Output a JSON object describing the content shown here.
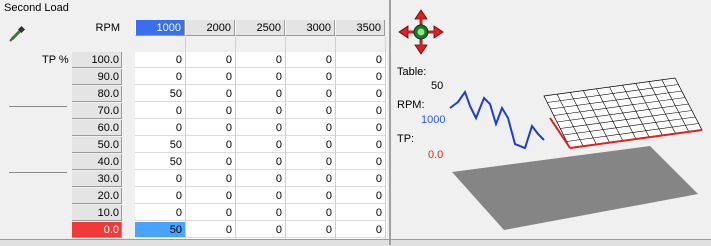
{
  "title": "Second Load",
  "axis": {
    "rpm_label": "RPM",
    "tp_label": "TP %"
  },
  "rpm": [
    "1000",
    "2000",
    "2500",
    "3000",
    "3500"
  ],
  "tp": [
    "100.0",
    "90.0",
    "80.0",
    "70.0",
    "60.0",
    "50.0",
    "40.0",
    "30.0",
    "20.0",
    "10.0",
    "0.0"
  ],
  "table": [
    [
      "0",
      "0",
      "0",
      "0",
      "0"
    ],
    [
      "0",
      "0",
      "0",
      "0",
      "0"
    ],
    [
      "50",
      "0",
      "0",
      "0",
      "0"
    ],
    [
      "0",
      "0",
      "0",
      "0",
      "0"
    ],
    [
      "0",
      "0",
      "0",
      "0",
      "0"
    ],
    [
      "50",
      "0",
      "0",
      "0",
      "0"
    ],
    [
      "50",
      "0",
      "0",
      "0",
      "0"
    ],
    [
      "0",
      "0",
      "0",
      "0",
      "0"
    ],
    [
      "0",
      "0",
      "0",
      "0",
      "0"
    ],
    [
      "0",
      "0",
      "0",
      "0",
      "0"
    ],
    [
      "50",
      "0",
      "0",
      "0",
      "0"
    ]
  ],
  "selected": {
    "rpm_index": 0,
    "tp_index": 10
  },
  "info": {
    "table_label": "Table:",
    "table_value": "50",
    "rpm_label": "RPM:",
    "rpm_value": "1000",
    "tp_label": "TP:",
    "tp_value": "0.0"
  },
  "icons": {
    "tool": "eyedropper-icon",
    "move": "move-arrows-icon"
  },
  "colors": {
    "rpm_highlight": "#3a6df0",
    "tp_highlight": "#f03a3a",
    "cell_highlight": "#4aa3ff",
    "surface_line": "#1a3fd0",
    "surface_edge": "#e02020",
    "shadow": "#8a8a8a"
  }
}
